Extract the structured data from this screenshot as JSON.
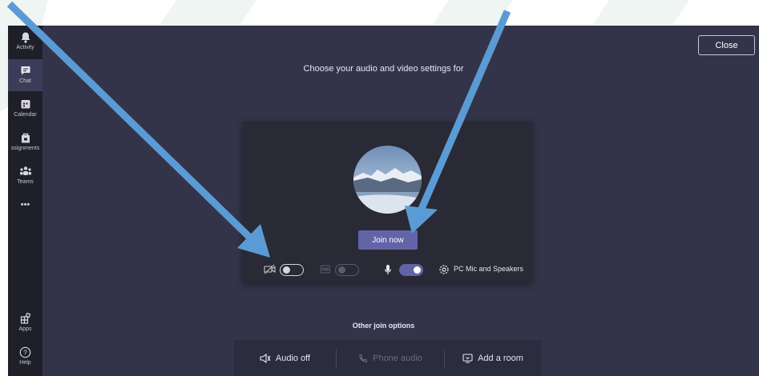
{
  "rail": {
    "items": [
      {
        "label": "Activity",
        "icon": "bell-icon"
      },
      {
        "label": "Chat",
        "icon": "chat-icon"
      },
      {
        "label": "Calendar",
        "icon": "calendar-icon"
      },
      {
        "label": "ssignments",
        "icon": "assignments-icon"
      },
      {
        "label": "Teams",
        "icon": "teams-icon"
      },
      {
        "label": "•••",
        "icon": "more-icon"
      }
    ],
    "apps_label": "Apps",
    "help_label": "Help",
    "active": "Chat"
  },
  "close_label": "Close",
  "heading": "Choose your audio and video settings for",
  "preview": {
    "join_label": "Join now",
    "device_label": "PC Mic and Speakers",
    "camera_on": false,
    "background_blur_on": false,
    "mic_on": true
  },
  "other": {
    "title": "Other join options",
    "audio_off": "Audio off",
    "phone_audio": "Phone audio",
    "add_room": "Add a room"
  },
  "colors": {
    "accent": "#6264a7",
    "rail": "#1f1f2a",
    "stage": "#33344a",
    "card": "#292a36",
    "annotation_arrow": "#5b9bd5"
  }
}
